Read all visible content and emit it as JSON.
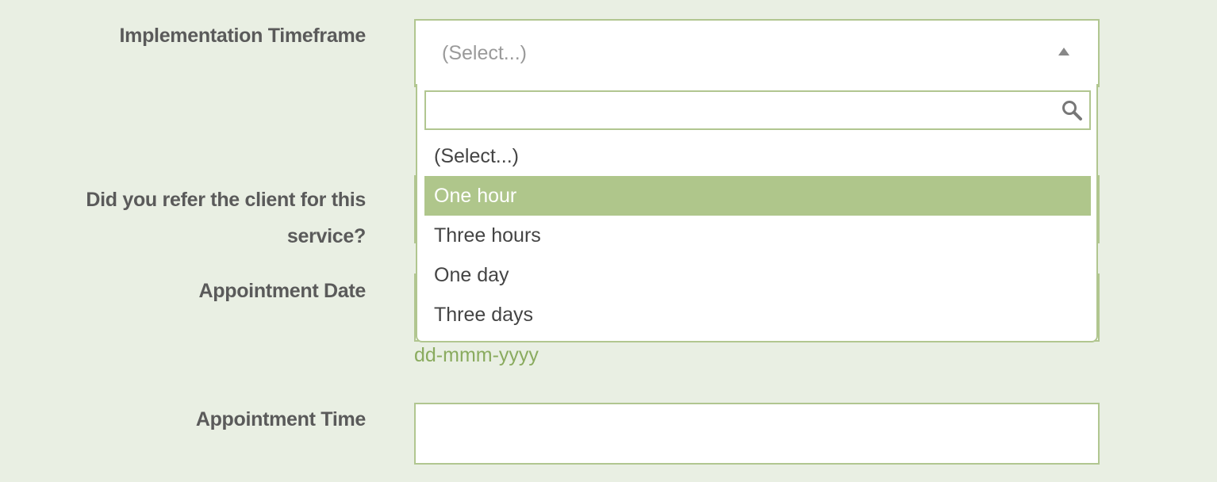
{
  "labels": {
    "implementation_timeframe": "Implementation Timeframe",
    "refer_client": "Did you refer the client for this service?",
    "appointment_date": "Appointment Date",
    "appointment_time": "Appointment Time"
  },
  "timeframe_select": {
    "value": "(Select...)",
    "search_value": "",
    "options": [
      {
        "label": "(Select...)"
      },
      {
        "label": "One hour",
        "highlighted": true
      },
      {
        "label": "Three hours"
      },
      {
        "label": "One day"
      },
      {
        "label": "Three days"
      }
    ]
  },
  "appointment_date": {
    "format_hint": "dd-mmm-yyyy"
  },
  "appointment_time": {
    "value": ""
  },
  "colors": {
    "background": "#e9efe3",
    "border": "#b1c690",
    "highlight": "#afc68b",
    "hint": "#8aab5f"
  },
  "icons": {
    "search": "search-icon",
    "arrow": "triangle-up-icon"
  }
}
